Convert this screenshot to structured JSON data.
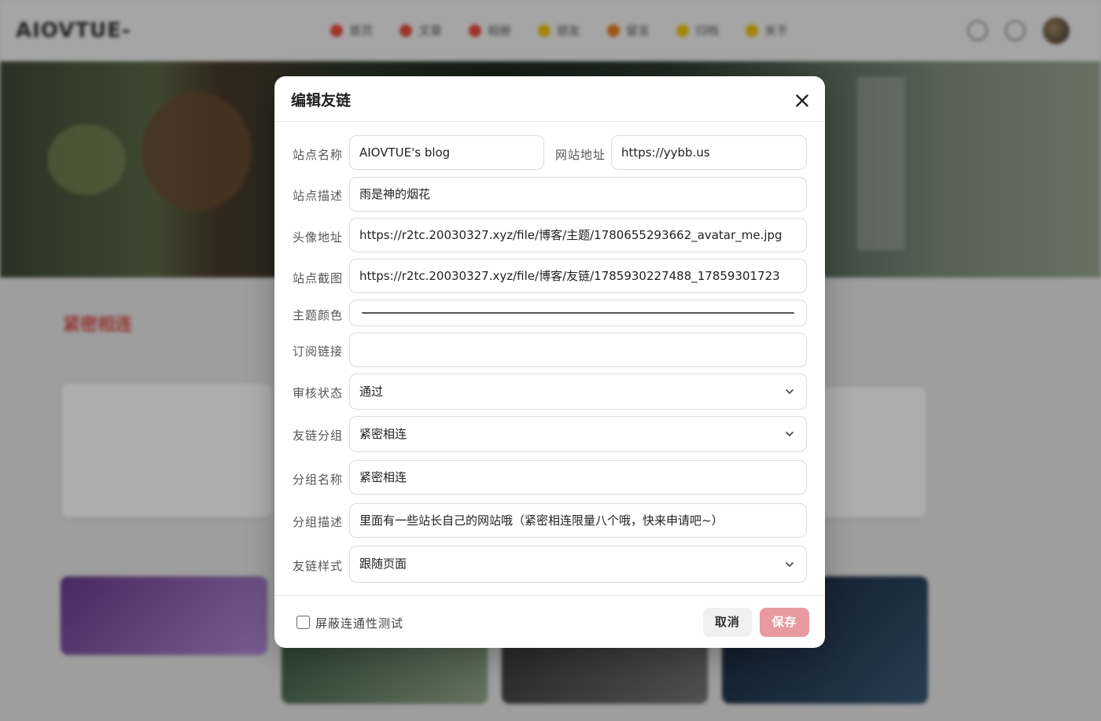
{
  "background": {
    "brand": "AIOVTUE-",
    "nav": [
      {
        "label": "首页",
        "color": "#e74c3c"
      },
      {
        "label": "文章",
        "color": "#e74c3c"
      },
      {
        "label": "相册",
        "color": "#e74c3c"
      },
      {
        "label": "朋友",
        "color": "#f1c40f"
      },
      {
        "label": "留言",
        "color": "#e67e22"
      },
      {
        "label": "归档",
        "color": "#f1c40f"
      },
      {
        "label": "关于",
        "color": "#f1c40f"
      }
    ],
    "section_title": "紧密相连"
  },
  "modal": {
    "title": "编辑友链",
    "fields": {
      "site_name": {
        "label": "站点名称",
        "value": "AIOVTUE's blog"
      },
      "site_url": {
        "label": "网站地址",
        "value": "https://yybb.us"
      },
      "site_desc": {
        "label": "站点描述",
        "value": "雨是神的烟花"
      },
      "avatar_url": {
        "label": "头像地址",
        "value": "https://r2tc.20030327.xyz/file/博客/主题/1780655293662_avatar_me.jpg"
      },
      "screenshot_url": {
        "label": "站点截图",
        "value": "https://r2tc.20030327.xyz/file/博客/友链/1785930227488_17859301723"
      },
      "theme_color": {
        "label": "主题颜色",
        "value": "#555555"
      },
      "rss_url": {
        "label": "订阅链接",
        "value": ""
      },
      "review_status": {
        "label": "审核状态",
        "value": "通过"
      },
      "link_group": {
        "label": "友链分组",
        "value": "紧密相连"
      },
      "group_name": {
        "label": "分组名称",
        "value": "紧密相连"
      },
      "group_desc": {
        "label": "分组描述",
        "value": "里面有一些站长自己的网站哦（紧密相连限量八个哦，快来申请吧~）"
      },
      "link_style": {
        "label": "友链样式",
        "value": "跟随页面"
      }
    },
    "footer": {
      "checkbox_label": "屏蔽连通性测试",
      "checkbox_checked": false,
      "cancel_label": "取消",
      "save_label": "保存"
    }
  },
  "colors": {
    "save_button": "#e89aa0",
    "cancel_button": "#f0f0f0",
    "overlay": "rgba(0,0,0,0.32)"
  },
  "icons": {
    "close": "close-icon",
    "select": "chevron-down-icon"
  }
}
